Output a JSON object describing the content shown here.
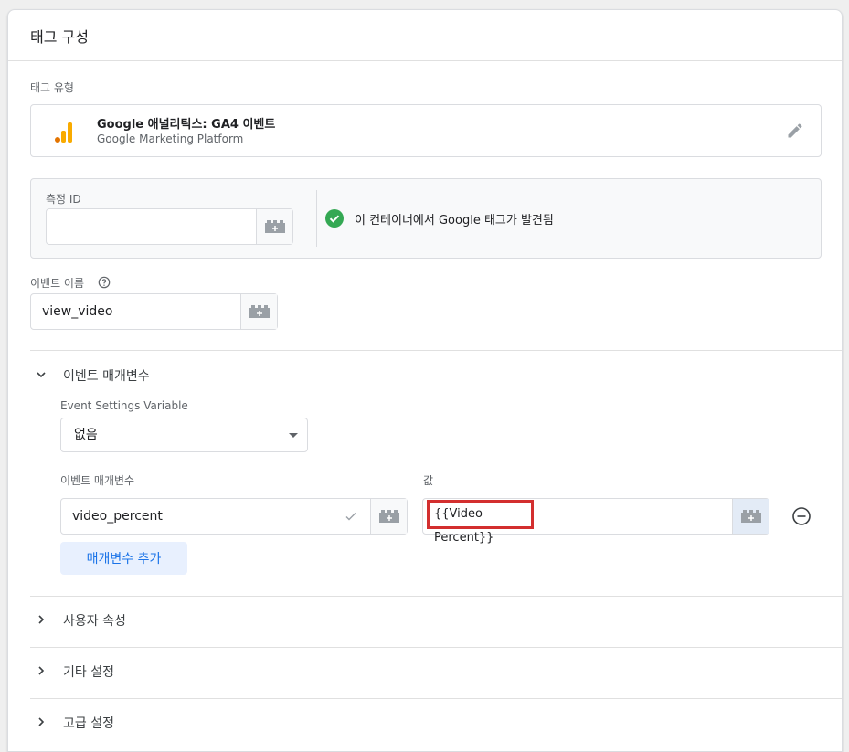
{
  "title": "태그 구성",
  "tag_type": {
    "label": "태그 유형",
    "name": "Google 애널리틱스: GA4 이벤트",
    "platform": "Google Marketing Platform",
    "logo_icon": "google-analytics-icon",
    "edit_icon": "pencil-icon"
  },
  "measurement": {
    "label": "측정 ID",
    "value": "",
    "status_text": "이 컨테이너에서 Google 태그가 발견됨",
    "status_icon": "check-circle-icon",
    "status_color": "#34a853"
  },
  "event_name": {
    "label": "이벤트 이름",
    "value": "view_video"
  },
  "event_params": {
    "section_label": "이벤트 매개변수",
    "settings_variable_label": "Event Settings Variable",
    "settings_variable_value": "없음",
    "param_column_label": "이벤트 매개변수",
    "value_column_label": "값",
    "rows": [
      {
        "param": "video_percent",
        "value": "{{Video Percent}}"
      }
    ],
    "add_button_label": "매개변수 추가"
  },
  "sections": [
    {
      "label": "사용자 속성"
    },
    {
      "label": "기타 설정"
    },
    {
      "label": "고급 설정"
    }
  ],
  "colors": {
    "accent": "#1a73e8",
    "highlight_border": "#d32f2f",
    "ga_orange": "#f9ab00",
    "ga_dark_orange": "#e37400"
  }
}
